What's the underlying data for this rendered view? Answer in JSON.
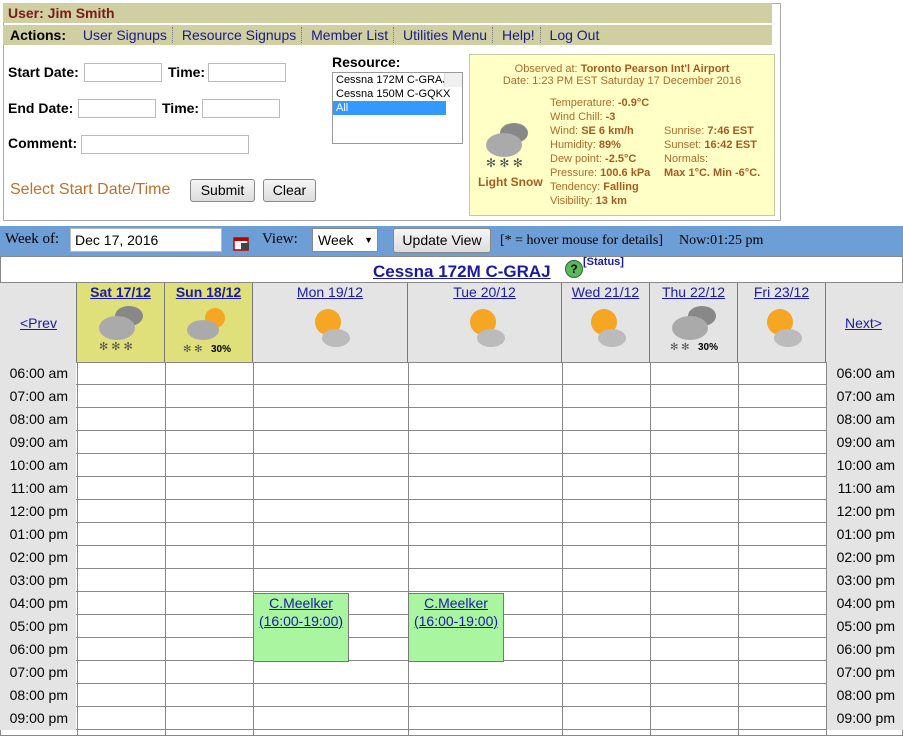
{
  "user": "User: Jim Smith",
  "actions_label": "Actions:",
  "actions": [
    "User Signups",
    "Resource Signups",
    "Member List",
    "Utilities Menu",
    "Help!",
    "Log Out"
  ],
  "form": {
    "start_date": "Start Date:",
    "time1": "Time:",
    "end_date": "End Date:",
    "time2": "Time:",
    "comment": "Comment:",
    "prompt": "Select Start Date/Time",
    "submit": "Submit",
    "clear": "Clear"
  },
  "resource": {
    "label": "Resource:",
    "options": [
      "Cessna 172M C-GRAJ",
      "Cessna 150M C-GQKX",
      "All"
    ],
    "selected": "All"
  },
  "weather": {
    "observed": "Observed at:",
    "station": "Toronto Pearson Int'l Airport",
    "date": "Date: 1:23 PM EST Saturday 17 December 2016",
    "condition": "Light Snow",
    "temp_l": "Temperature:",
    "temp": "-0.9°C",
    "chill_l": "Wind Chill:",
    "chill": "-3",
    "wind_l": "Wind:",
    "wind": "SE 6 km/h",
    "hum_l": "Humidity:",
    "hum": "89%",
    "dew_l": "Dew point:",
    "dew": "-2.5°C",
    "press_l": "Pressure:",
    "press": "100.6 kPa",
    "tend_l": "Tendency:",
    "tend": "Falling",
    "vis_l": "Visibility:",
    "vis": "13 km",
    "sunrise_l": "Sunrise:",
    "sunrise": "7:46 EST",
    "sunset_l": "Sunset:",
    "sunset": "16:42 EST",
    "normals_l": "Normals:",
    "normals": "Max 1°C. Min -6°C."
  },
  "toolbar": {
    "week_of": "Week of:",
    "week_value": "Dec 17, 2016",
    "view": "View:",
    "view_value": "Week",
    "update": "Update View",
    "hint": "[* = hover mouse for details]",
    "now": "Now:01:25 pm"
  },
  "calendar": {
    "title": "Cessna 172M C-GRAJ",
    "status": "[Status]",
    "prev": "<Prev",
    "next": "Next>",
    "days": [
      {
        "label": "Sat 17/12",
        "icon": "snow-cloud-icon",
        "pop": ""
      },
      {
        "label": "Sun 18/12",
        "icon": "sun-snow-icon",
        "pop": "30%"
      },
      {
        "label": "Mon 19/12",
        "icon": "sun-cloud-icon",
        "pop": ""
      },
      {
        "label": "Tue 20/12",
        "icon": "sun-cloud-icon",
        "pop": ""
      },
      {
        "label": "Wed 21/12",
        "icon": "sun-cloud-icon",
        "pop": ""
      },
      {
        "label": "Thu 22/12",
        "icon": "snow-cloud-icon",
        "pop": "30%"
      },
      {
        "label": "Fri 23/12",
        "icon": "sun-cloud-icon",
        "pop": ""
      }
    ],
    "times": [
      "06:00 am",
      "07:00 am",
      "08:00 am",
      "09:00 am",
      "10:00 am",
      "11:00 am",
      "12:00 pm",
      "01:00 pm",
      "02:00 pm",
      "03:00 pm",
      "04:00 pm",
      "05:00 pm",
      "06:00 pm",
      "07:00 pm",
      "08:00 pm",
      "09:00 pm"
    ],
    "bookings": [
      {
        "who": "C.Meelker",
        "time": "(16:00-19:00)"
      },
      {
        "who": "C.Meelker",
        "time": "(16:00-19:00)"
      }
    ]
  },
  "colors": {
    "header_bar": "#cfcfa1",
    "toolbar": "#6d9ed6",
    "today": "#e0e07a",
    "booking": "#a9f5a0"
  }
}
